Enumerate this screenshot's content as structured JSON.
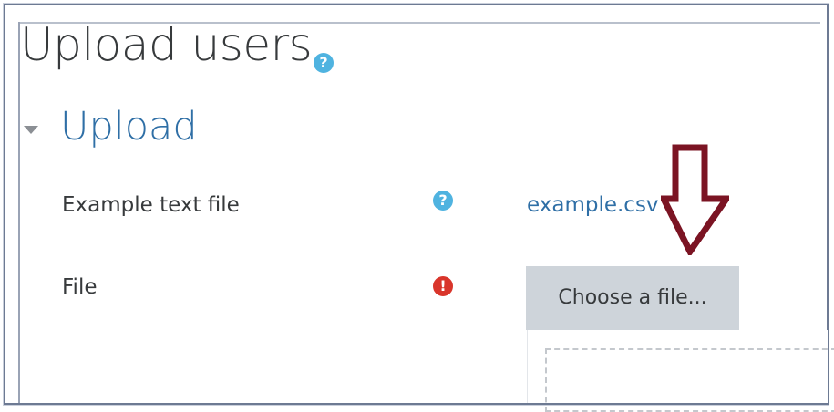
{
  "header": {
    "page_title": "Upload users",
    "help_glyph": "?"
  },
  "section": {
    "title": "Upload"
  },
  "form": {
    "example_label": "Example text file",
    "example_help_glyph": "?",
    "example_link": "example.csv",
    "file_label": "File",
    "file_required_glyph": "!",
    "choose_button": "Choose a file..."
  },
  "icons": {
    "title_help": "help-question-icon",
    "section_toggle": "caret-down-icon",
    "row_help": "help-question-icon",
    "required": "required-exclamation-icon",
    "annotation": "down-arrow-annotation-icon"
  },
  "colors": {
    "link": "#2f6fa6",
    "help": "#4fb3e0",
    "required": "#d9352b",
    "button": "#ced4da",
    "arrow": "#7b1423"
  }
}
